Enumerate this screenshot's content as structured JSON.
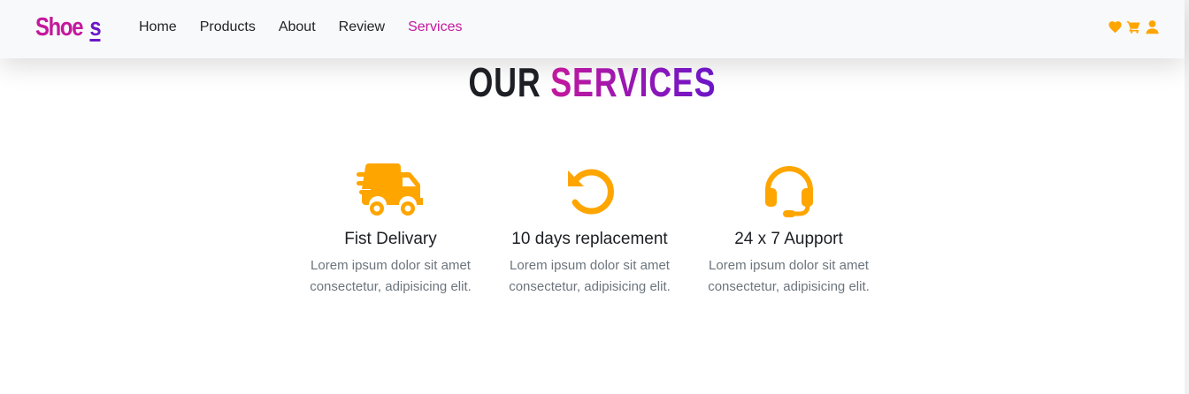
{
  "brand": {
    "text": "Shoe",
    "s": "s"
  },
  "nav": {
    "links": [
      "Home",
      "Products",
      "About",
      "Review",
      "Services"
    ],
    "active": "Services",
    "icons": [
      "heart-icon",
      "cart-icon",
      "user-icon"
    ]
  },
  "section": {
    "title_part1": "OUR",
    "title_part2": "SERVICES"
  },
  "services": [
    {
      "icon": "truck-fast-icon",
      "title": "Fist Delivary",
      "desc_line1": "Lorem ipsum dolor sit amet",
      "desc_line2": "consectetur, adipisicing elit."
    },
    {
      "icon": "rotate-left-icon",
      "title": "10 days replacement",
      "desc_line1": "Lorem ipsum dolor sit amet",
      "desc_line2": "consectetur, adipisicing elit."
    },
    {
      "icon": "headset-icon",
      "title": "24 x 7 Aupport",
      "desc_line1": "Lorem ipsum dolor sit amet",
      "desc_line2": "consectetur, adipisicing elit."
    }
  ],
  "colors": {
    "brand_pink": "#c4189c",
    "brand_purple": "#6a16c9",
    "icon_orange": "#ffa500",
    "text_dark": "#1d1f24",
    "text_muted": "#6c757d",
    "navbar_bg": "#f8f9fa"
  }
}
